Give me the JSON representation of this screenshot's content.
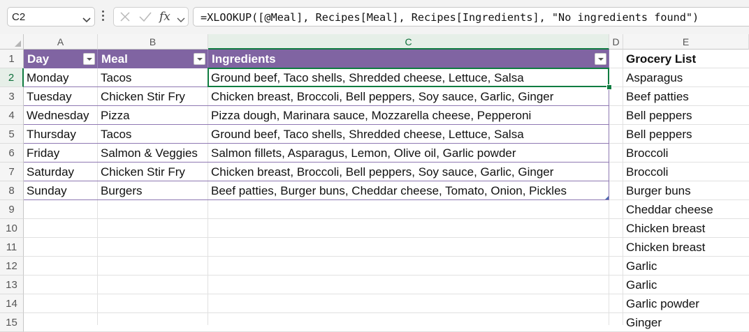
{
  "name_box": {
    "value": "C2"
  },
  "formula_bar": {
    "formula": "=XLOOKUP([@Meal], Recipes[Meal], Recipes[Ingredients], \"No ingredients found\")",
    "fx_label": "fx"
  },
  "columns": [
    "A",
    "B",
    "C",
    "D",
    "E"
  ],
  "rows": [
    "1",
    "2",
    "3",
    "4",
    "5",
    "6",
    "7",
    "8",
    "9",
    "10",
    "11",
    "12",
    "13",
    "14",
    "15"
  ],
  "table": {
    "headers": [
      "Day",
      "Meal",
      "Ingredients"
    ],
    "header_color": "#8064a2",
    "rows": [
      [
        "Monday",
        "Tacos",
        "Ground beef, Taco shells, Shredded cheese, Lettuce, Salsa"
      ],
      [
        "Tuesday",
        "Chicken Stir Fry",
        "Chicken breast, Broccoli, Bell peppers, Soy sauce, Garlic, Ginger"
      ],
      [
        "Wednesday",
        "Pizza",
        "Pizza dough, Marinara sauce, Mozzarella cheese, Pepperoni"
      ],
      [
        "Thursday",
        "Tacos",
        "Ground beef, Taco shells, Shredded cheese, Lettuce, Salsa"
      ],
      [
        "Friday",
        "Salmon & Veggies",
        "Salmon fillets, Asparagus, Lemon, Olive oil, Garlic powder"
      ],
      [
        "Saturday",
        "Chicken Stir Fry",
        "Chicken breast, Broccoli, Bell peppers, Soy sauce, Garlic, Ginger"
      ],
      [
        "Sunday",
        "Burgers",
        "Beef patties, Burger buns, Cheddar cheese, Tomato, Onion, Pickles"
      ]
    ]
  },
  "grocery_list": {
    "header": "Grocery List",
    "items": [
      "Asparagus",
      "Beef patties",
      "Bell peppers",
      "Bell peppers",
      "Broccoli",
      "Broccoli",
      "Burger buns",
      "Cheddar cheese",
      "Chicken breast",
      "Chicken breast",
      "Garlic",
      "Garlic",
      "Garlic powder",
      "Ginger"
    ]
  },
  "selection": {
    "cell": "C2",
    "column": "C",
    "row": "2",
    "accent": "#107c41"
  }
}
